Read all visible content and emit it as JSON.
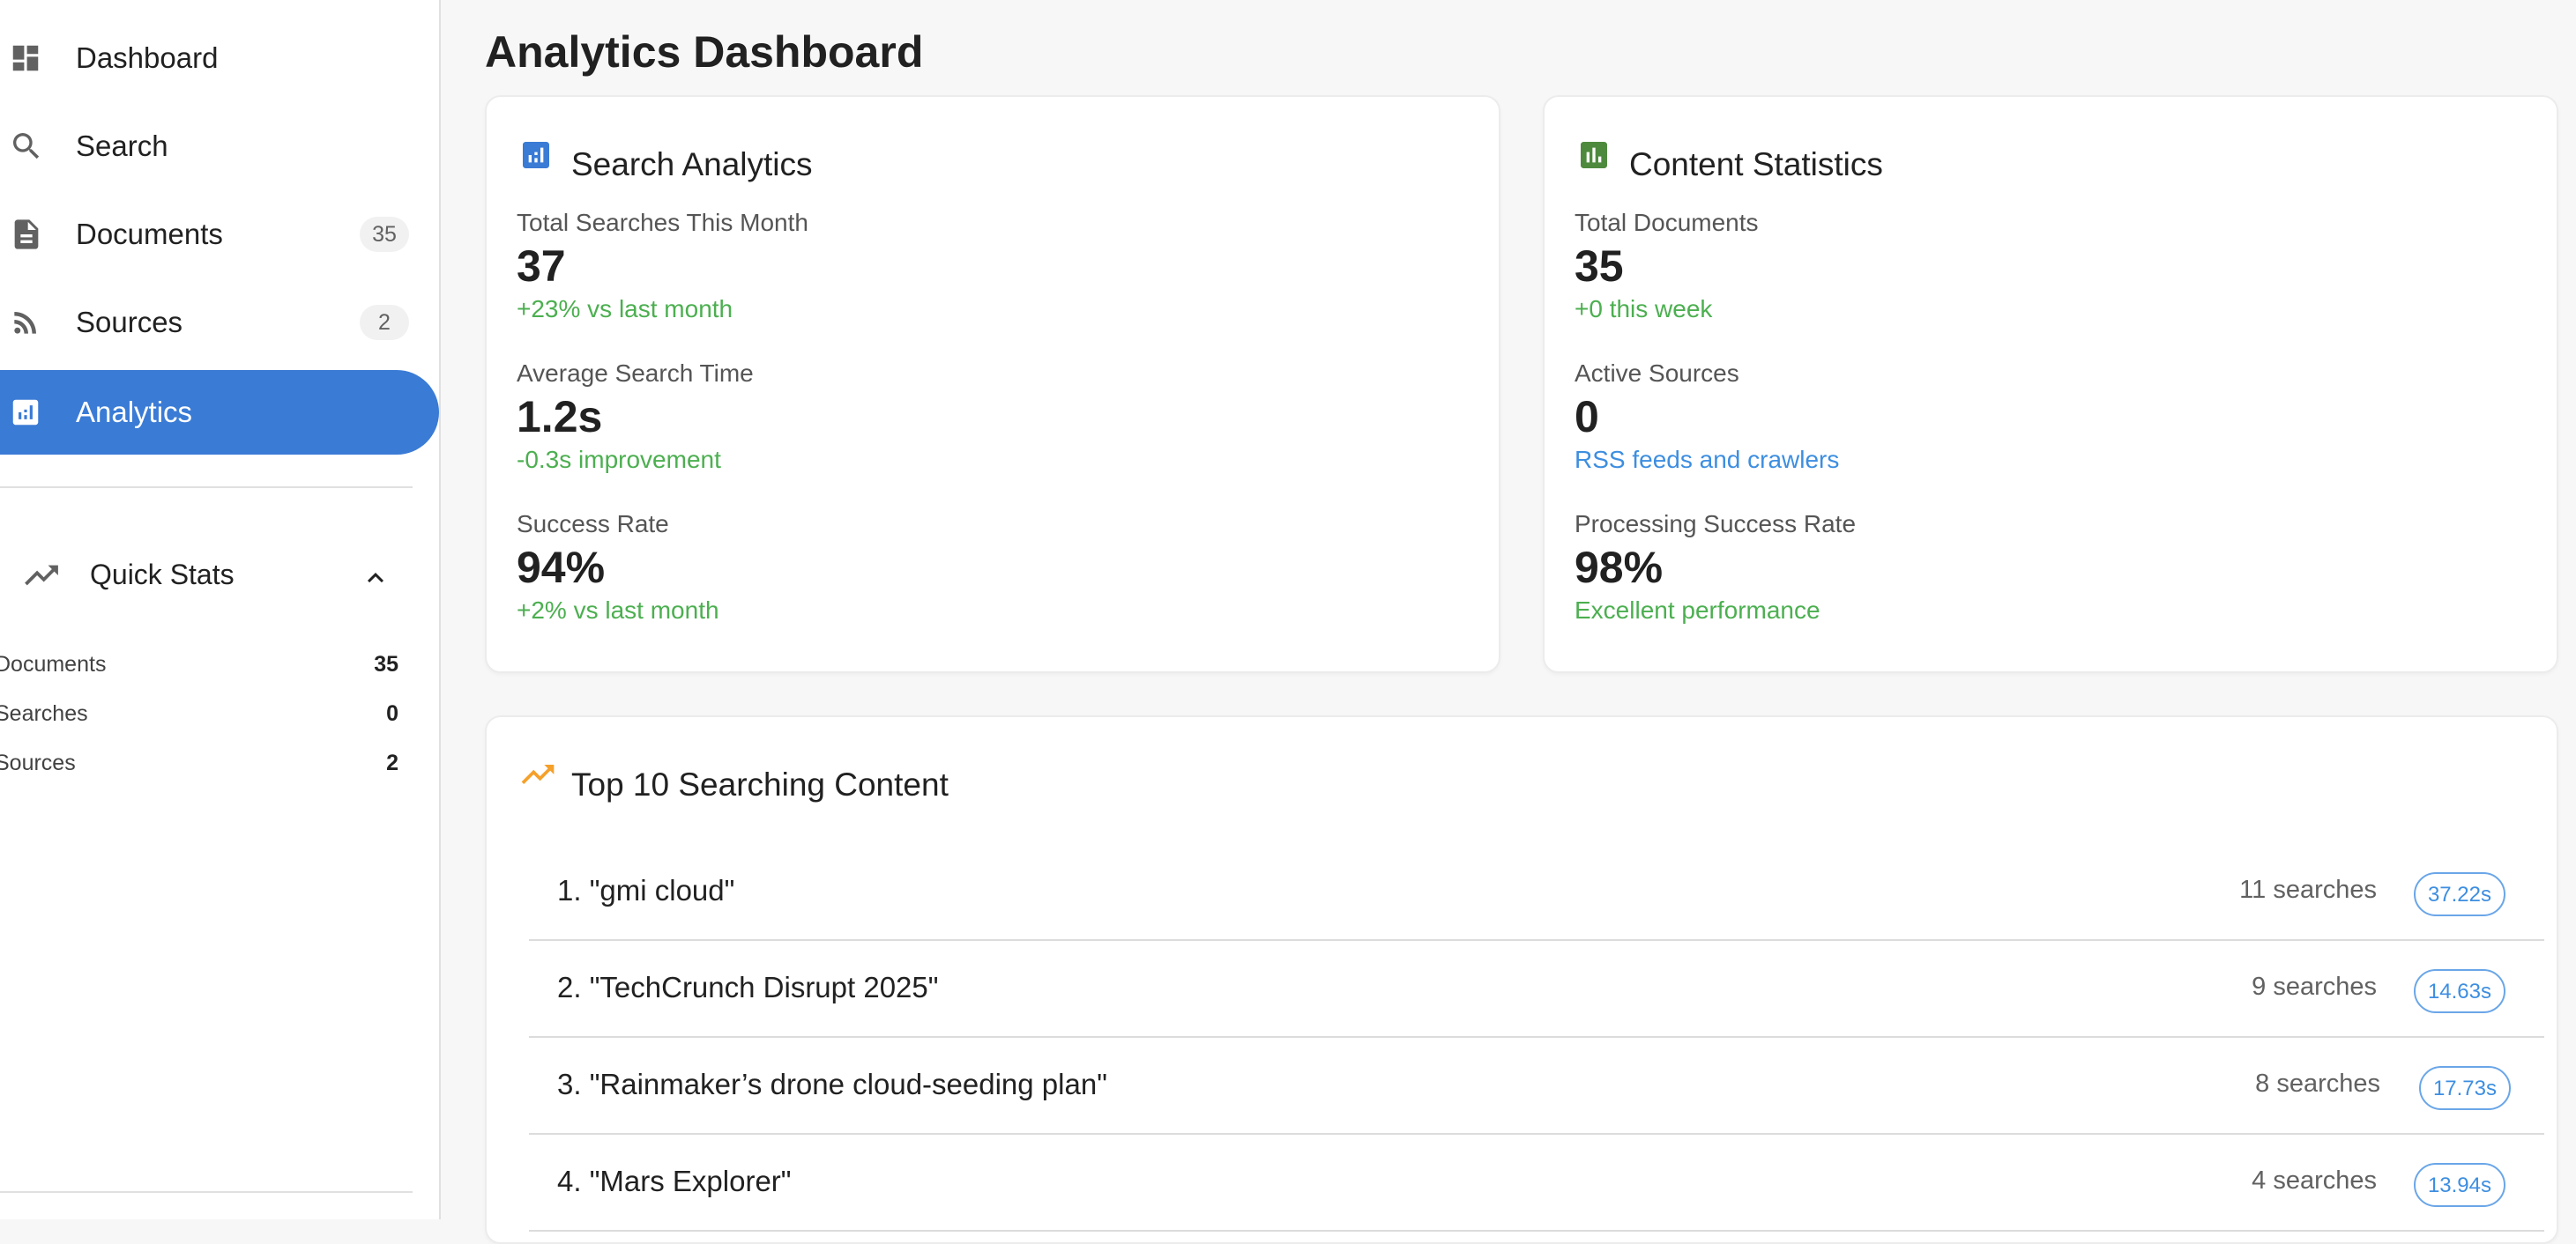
{
  "sidebar": {
    "items": [
      {
        "label": "Dashboard",
        "icon": "dashboard-icon"
      },
      {
        "label": "Search",
        "icon": "search-icon"
      },
      {
        "label": "Documents",
        "count": "35",
        "icon": "document-icon"
      },
      {
        "label": "Sources",
        "count": "2",
        "icon": "rss-icon"
      },
      {
        "label": "Analytics",
        "icon": "analytics-icon",
        "active": true
      }
    ],
    "quick_stats": {
      "title": "Quick Stats",
      "icon": "trending-up-icon",
      "rows": [
        {
          "label": "Documents",
          "value": "35"
        },
        {
          "label": "Searches",
          "value": "0"
        },
        {
          "label": "Sources",
          "value": "2"
        }
      ]
    }
  },
  "page": {
    "title": "Analytics Dashboard"
  },
  "search_analytics": {
    "title": "Search Analytics",
    "metrics": [
      {
        "label": "Total Searches This Month",
        "value": "37",
        "sub": "+23% vs last month"
      },
      {
        "label": "Average Search Time",
        "value": "1.2s",
        "sub": "-0.3s improvement"
      },
      {
        "label": "Success Rate",
        "value": "94%",
        "sub": "+2% vs last month"
      }
    ]
  },
  "content_statistics": {
    "title": "Content Statistics",
    "metrics": [
      {
        "label": "Total Documents",
        "value": "35",
        "sub": "+0 this week"
      },
      {
        "label": "Active Sources",
        "value": "0",
        "sub": "RSS feeds and crawlers"
      },
      {
        "label": "Processing Success Rate",
        "value": "98%",
        "sub": "Excellent performance"
      }
    ]
  },
  "top_content": {
    "title": "Top 10 Searching Content",
    "items": [
      {
        "rank": "1. \"gmi cloud\"",
        "searches": "11 searches",
        "time": "37.22s"
      },
      {
        "rank": "2. \"TechCrunch Disrupt 2025\"",
        "searches": "9 searches",
        "time": "14.63s"
      },
      {
        "rank": "3. \"Rainmaker’s drone cloud-seeding plan\"",
        "searches": "8 searches",
        "time": "17.73s"
      },
      {
        "rank": "4. \"Mars Explorer\"",
        "searches": "4 searches",
        "time": "13.94s"
      }
    ]
  },
  "colors": {
    "accent": "#3a7bd5",
    "positive": "#4caf50",
    "info": "#3d8ee0",
    "orange": "#f5a02a",
    "green_icon": "#4e8a3e"
  }
}
